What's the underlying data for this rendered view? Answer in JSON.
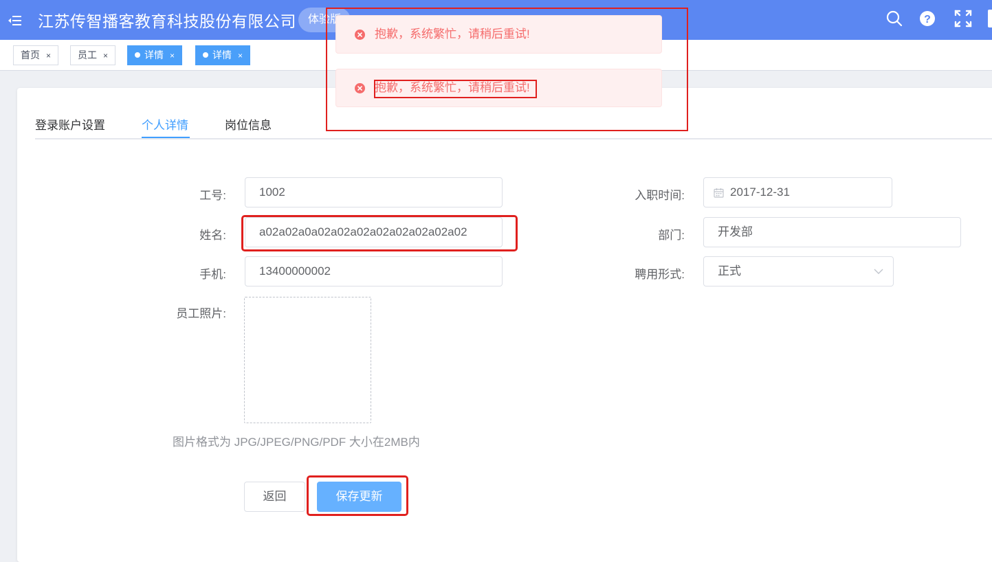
{
  "header": {
    "company": "江苏传智播客教育科技股份有限公司",
    "edition_badge": "体验版",
    "icons": [
      "menu-toggle-icon",
      "search-icon",
      "help-icon",
      "fullscreen-icon"
    ]
  },
  "tags": [
    {
      "label": "首页",
      "close": "×",
      "active": false
    },
    {
      "label": "员工",
      "close": "×",
      "active": false
    },
    {
      "label": "详情",
      "close": "×",
      "active": true
    },
    {
      "label": "详情",
      "close": "×",
      "active": true
    }
  ],
  "tabs": [
    {
      "label": "登录账户设置",
      "active": false
    },
    {
      "label": "个人详情",
      "active": true
    },
    {
      "label": "岗位信息",
      "active": false
    }
  ],
  "form": {
    "employee_id": {
      "label": "工号:",
      "value": "1002"
    },
    "name": {
      "label": "姓名:",
      "value": "a02a02a0a02a02a02a02a02a02a02a02"
    },
    "phone": {
      "label": "手机:",
      "value": "13400000002"
    },
    "photo": {
      "label": "员工照片:"
    },
    "hire_date": {
      "label": "入职时间:",
      "value": "2017-12-31"
    },
    "department": {
      "label": "部门:",
      "value": "开发部"
    },
    "employment_type": {
      "label": "聘用形式:",
      "value": "正式"
    },
    "photo_hint": "图片格式为 JPG/JPEG/PNG/PDF 大小在2MB内"
  },
  "buttons": {
    "back": "返回",
    "save": "保存更新"
  },
  "messages": [
    {
      "text": "抱歉，系统繁忙，请稍后重试!",
      "type": "error"
    },
    {
      "text": "抱歉，系统繁忙，请稍后重试!",
      "type": "error"
    }
  ],
  "colors": {
    "header": "#5b87f2",
    "accent": "#409eff",
    "error_text": "#f56c6c",
    "error_bg": "#fef0f0",
    "annotation": "#e0201e"
  }
}
